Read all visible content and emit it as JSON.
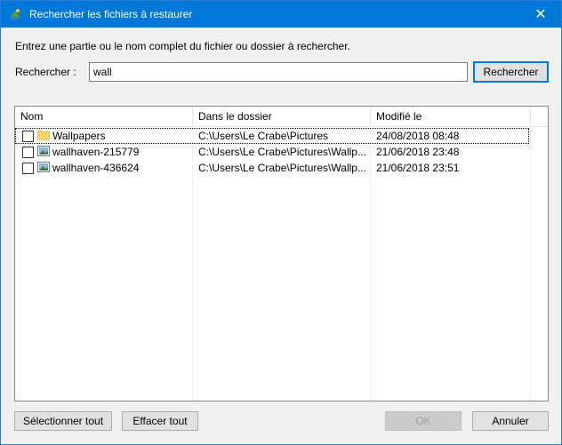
{
  "window": {
    "title": "Rechercher les fichiers à restaurer",
    "close_glyph": "✕"
  },
  "instruction": "Entrez une partie ou le nom complet du fichier ou dossier à rechercher.",
  "search": {
    "label": "Rechercher :",
    "value": "wall",
    "button": "Rechercher"
  },
  "table": {
    "columns": [
      "Nom",
      "Dans le dossier",
      "Modifié le"
    ],
    "rows": [
      {
        "icon": "folder-icon",
        "name": "Wallpapers",
        "folder": "C:\\Users\\Le Crabe\\Pictures",
        "modified": "24/08/2018 08:48",
        "checked": false
      },
      {
        "icon": "image-file-icon",
        "name": "wallhaven-215779",
        "folder": "C:\\Users\\Le Crabe\\Pictures\\Wallp...",
        "modified": "21/06/2018 23:48",
        "checked": false
      },
      {
        "icon": "image-file-icon",
        "name": "wallhaven-436624",
        "folder": "C:\\Users\\Le Crabe\\Pictures\\Wallp...",
        "modified": "21/06/2018 23:51",
        "checked": false
      }
    ]
  },
  "buttons": {
    "select_all": "Sélectionner tout",
    "clear_all": "Effacer tout",
    "ok": "OK",
    "cancel": "Annuler"
  },
  "colors": {
    "titlebar": "#0078d7",
    "folder": "#f7d46b",
    "window_bg": "#f0f0f0"
  }
}
